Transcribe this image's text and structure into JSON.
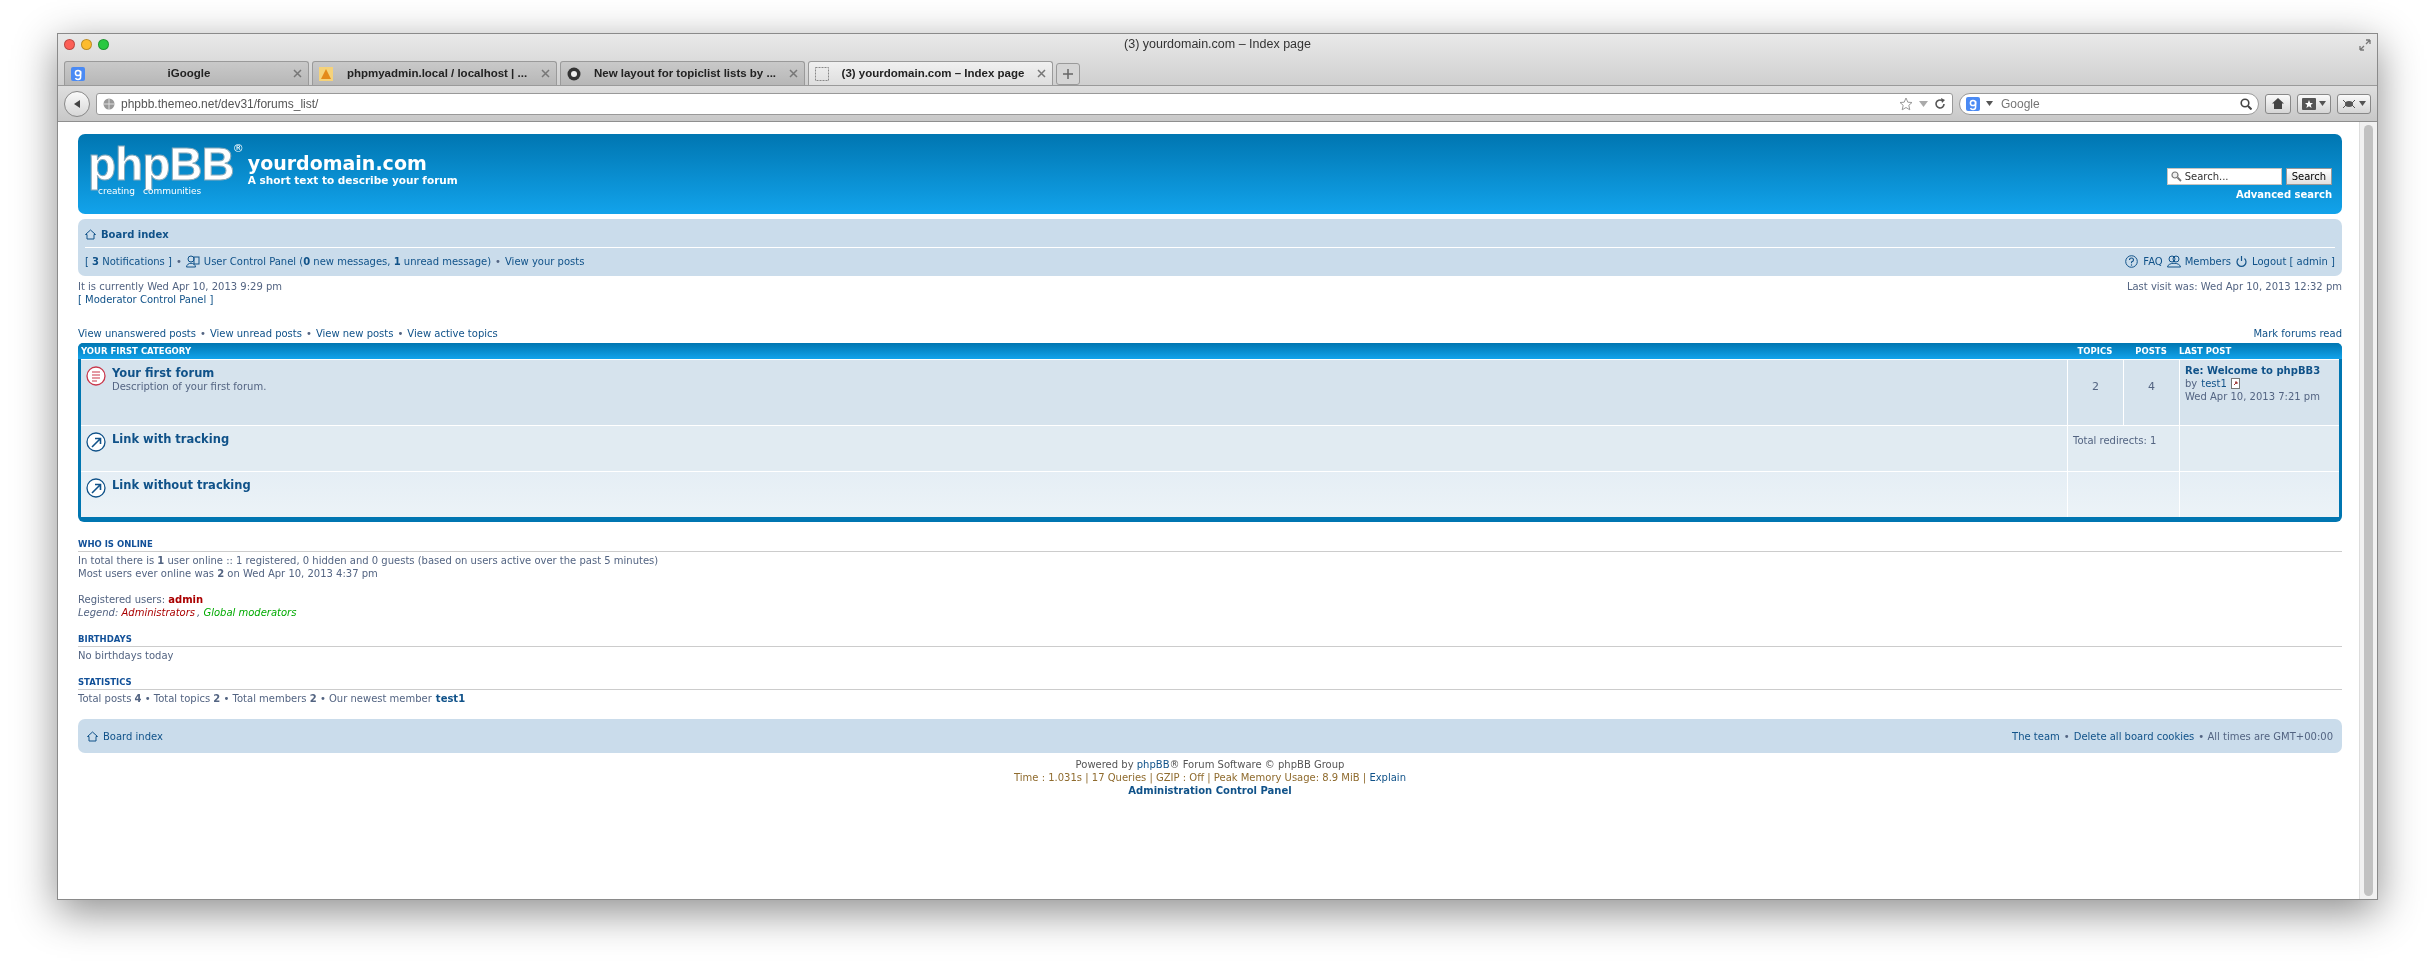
{
  "window": {
    "title": "(3) yourdomain.com – Index page"
  },
  "tabs": [
    {
      "label": "iGoogle",
      "selected": false
    },
    {
      "label": "phpmyadmin.local / localhost | ...",
      "selected": false
    },
    {
      "label": "New layout for topiclist lists by ...",
      "selected": false
    },
    {
      "label": "(3) yourdomain.com – Index page",
      "selected": true
    }
  ],
  "toolbar": {
    "url": "phpbb.themeo.net/dev31/forums_list/",
    "search_placeholder": "Google"
  },
  "header": {
    "logo": {
      "name": "phpBB",
      "mark": "®",
      "tagline": [
        "creating",
        "communities"
      ]
    },
    "site_name": "yourdomain.com",
    "site_description": "A short text to describe your forum",
    "search_placeholder": "Search...",
    "search_button": "Search",
    "advanced_search": "Advanced search"
  },
  "navbar": {
    "breadcrumb": "Board index",
    "left": [
      {
        "text": "[ **3** Notifications ]"
      },
      {
        "sep": "•",
        "text": "User Control Panel (**0** new messages, **1** unread message)"
      },
      {
        "sep": "•",
        "text": "View your posts"
      }
    ],
    "right": [
      {
        "text": "FAQ"
      },
      {
        "text": "Members"
      },
      {
        "text": "Logout [ admin ]"
      }
    ]
  },
  "current_time": "It is currently Wed Apr 10, 2013 9:29 pm",
  "last_visit": "Last visit was: Wed Apr 10, 2013 12:32 pm",
  "moderator_link": "[ Moderator Control Panel ]",
  "quick_links": [
    {
      "text": "View unanswered posts"
    },
    {
      "sep": "•",
      "text": "View unread posts"
    },
    {
      "sep": "•",
      "text": "View new posts"
    },
    {
      "sep": "•",
      "text": "View active topics"
    }
  ],
  "mark_read": "Mark forums read",
  "forum_table": {
    "category": "YOUR FIRST CATEGORY",
    "columns": [
      "TOPICS",
      "POSTS",
      "LAST POST"
    ],
    "rows": [
      {
        "kind": "forum",
        "title": "Your first forum",
        "description": "Description of your first forum.",
        "topics": "2",
        "posts": "4",
        "last_post": {
          "title": "Re: Welcome to phpBB3",
          "by": "by",
          "author": "test1",
          "time": "Wed Apr 10, 2013 7:21 pm"
        }
      },
      {
        "kind": "link",
        "title": "Link with tracking",
        "redirects": "Total redirects: 1"
      },
      {
        "kind": "link",
        "title": "Link without tracking"
      }
    ]
  },
  "who_is_online": {
    "heading": "WHO IS ONLINE",
    "lines": [
      "In total there is **1** user online :: 1 registered, 0 hidden and 0 guests (based on users active over the past 5 minutes)",
      "Most users ever online was **2** on Wed Apr 10, 2013 4:37 pm"
    ],
    "registered_label": "Registered users:",
    "registered_users": [
      {
        "name": "admin",
        "color": "#aa0000"
      }
    ],
    "legend_label": "Legend:",
    "legend": [
      {
        "name": "Administrators",
        "sep": ",",
        "color": "#aa0000"
      },
      {
        "name": "Global moderators",
        "color": "#00aa00"
      }
    ]
  },
  "birthdays": {
    "heading": "BIRTHDAYS",
    "text": "No birthdays today"
  },
  "statistics": {
    "heading": "STATISTICS",
    "text": "Total posts **4** • Total topics **2** • Total members **2** • Our newest member",
    "newest_member": "test1"
  },
  "footer_bar": {
    "breadcrumb": "Board index",
    "links": [
      {
        "text": "The team"
      },
      {
        "sep": "•",
        "text": "Delete all board cookies"
      }
    ],
    "note": "• All times are GMT+00:00"
  },
  "footer": {
    "powered_prefix": "Powered by",
    "powered_link": "phpBB",
    "powered_suffix": "® Forum Software © phpBB Group",
    "debug": "Time : 1.031s | 17 Queries | GZIP : Off | Peak Memory Usage: 8.9 MiB |",
    "explain": "Explain",
    "acp": "Administration Control Panel"
  }
}
